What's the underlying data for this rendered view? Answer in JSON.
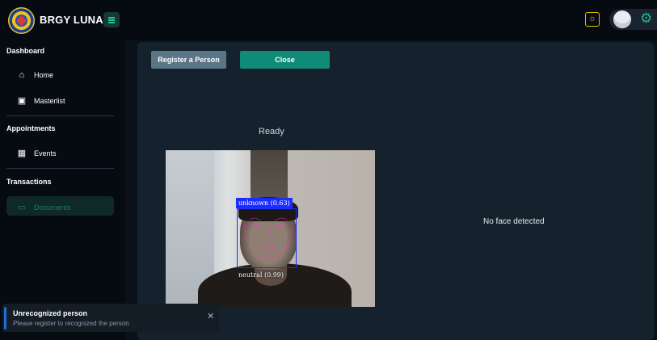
{
  "header": {
    "brand": "BRGY LUNA",
    "icons": [
      "barangay-seal-logo",
      "hamburger-menu-icon",
      "sun-icon",
      "avatar",
      "gear-icon"
    ]
  },
  "sidebar": {
    "sections": [
      {
        "title": "Dashboard",
        "items": [
          {
            "label": "Home",
            "icon": "home-icon"
          },
          {
            "label": "Masterlist",
            "icon": "clipboard-icon"
          }
        ]
      },
      {
        "title": "Appointments",
        "items": [
          {
            "label": "Events",
            "icon": "calendar-icon"
          }
        ]
      },
      {
        "title": "Transactions",
        "items": [
          {
            "label": "Documents",
            "icon": "folder-icon",
            "active": true
          }
        ]
      }
    ]
  },
  "main": {
    "register_label": "Register a Person",
    "close_label": "Close",
    "status": "Ready",
    "detection": {
      "face_label": "unknown (0.63)",
      "expression_label": "neutral (0.99)"
    },
    "right_status": "No face detected"
  },
  "toast": {
    "title": "Unrecognized person",
    "message": "Please register to recognized the person"
  },
  "colors": {
    "accent": "#0f8b77",
    "bbox": "#1b2cff",
    "landmarks": "#ff2bd6",
    "toast_bar": "#1e6fd9"
  }
}
